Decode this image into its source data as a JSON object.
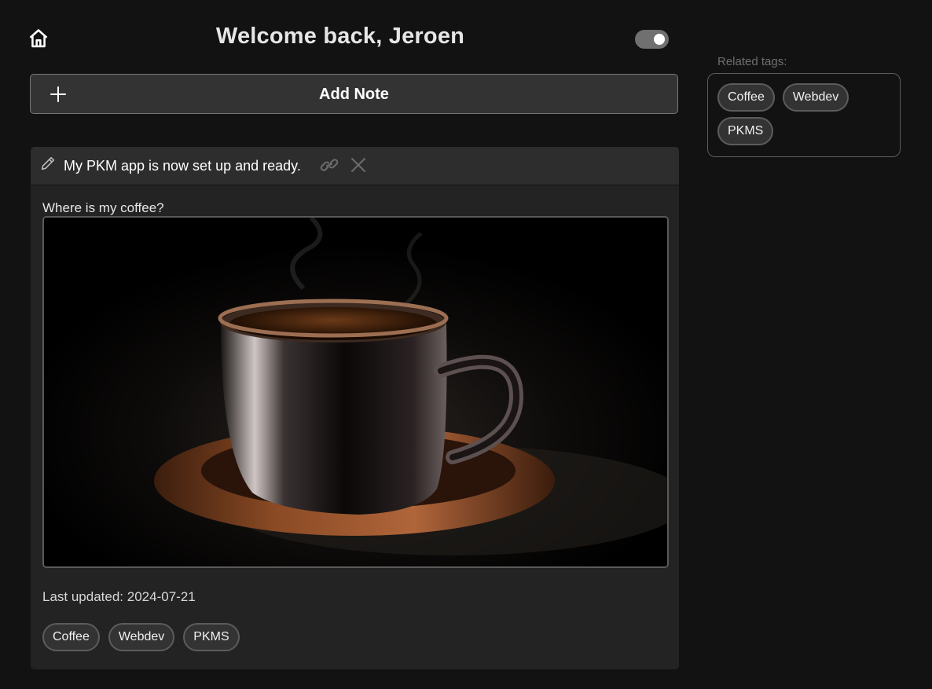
{
  "header": {
    "title": "Welcome back, Jeroen",
    "home_icon": "home-icon",
    "theme_toggle_on": true
  },
  "add_note": {
    "label": "Add Note",
    "icon": "plus-icon"
  },
  "note": {
    "title": "My PKM app is now set up and ready.",
    "body": "Where is my coffee?",
    "image_alt": "Cup of coffee",
    "last_updated_label": "Last updated: ",
    "last_updated_value": "2024-07-21",
    "tags": [
      "Coffee",
      "Webdev",
      "PKMS"
    ],
    "icons": [
      "edit-icon",
      "link-icon",
      "close-icon"
    ]
  },
  "sidebar": {
    "related_label": "Related tags:",
    "tags": [
      "Coffee",
      "Webdev",
      "PKMS"
    ]
  },
  "colors": {
    "background": "#121212",
    "card": "#232323",
    "card_header": "#2d2d2d",
    "button": "#333333",
    "toggle": "#707070"
  }
}
